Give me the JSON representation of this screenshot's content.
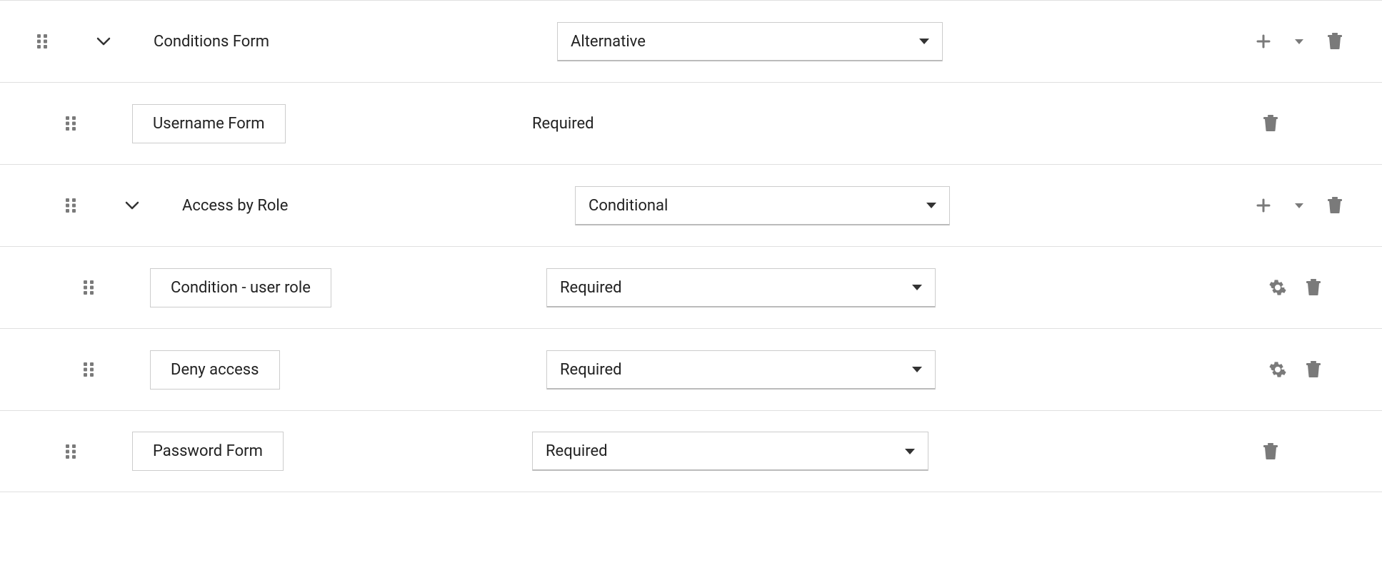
{
  "rows": [
    {
      "id": "conditions-form",
      "depth": 0,
      "expandable": true,
      "label": "Conditions Form",
      "labelStyle": "plain",
      "valueType": "select",
      "value": "Alternative",
      "actions": {
        "add": true,
        "addDropdown": true,
        "settings": false,
        "delete": true
      },
      "valueColLeft": 780,
      "selectWidth": 540
    },
    {
      "id": "username-form",
      "depth": 1,
      "expandable": false,
      "label": "Username Form",
      "labelStyle": "boxed",
      "valueType": "static",
      "value": "Required",
      "actions": {
        "add": false,
        "addDropdown": false,
        "settings": false,
        "delete": true
      },
      "valueColLeft": 745,
      "selectWidth": 540
    },
    {
      "id": "access-by-role",
      "depth": 1,
      "expandable": true,
      "label": "Access by Role",
      "labelStyle": "plain",
      "valueType": "select",
      "value": "Conditional",
      "actions": {
        "add": true,
        "addDropdown": true,
        "settings": false,
        "delete": true
      },
      "valueColLeft": 805,
      "selectWidth": 525
    },
    {
      "id": "condition-user-role",
      "depth": 2,
      "expandable": false,
      "label": "Condition - user role",
      "labelStyle": "boxed",
      "valueType": "select",
      "value": "Required",
      "actions": {
        "add": false,
        "addDropdown": false,
        "settings": true,
        "delete": true
      },
      "valueColLeft": 765,
      "selectWidth": 545
    },
    {
      "id": "deny-access",
      "depth": 2,
      "expandable": false,
      "label": "Deny access",
      "labelStyle": "boxed",
      "valueType": "select",
      "value": "Required",
      "actions": {
        "add": false,
        "addDropdown": false,
        "settings": true,
        "delete": true
      },
      "valueColLeft": 765,
      "selectWidth": 545
    },
    {
      "id": "password-form",
      "depth": 1,
      "expandable": false,
      "label": "Password Form",
      "labelStyle": "boxed",
      "valueType": "select",
      "value": "Required",
      "actions": {
        "add": false,
        "addDropdown": false,
        "settings": false,
        "delete": true
      },
      "valueColLeft": 745,
      "selectWidth": 555
    }
  ]
}
